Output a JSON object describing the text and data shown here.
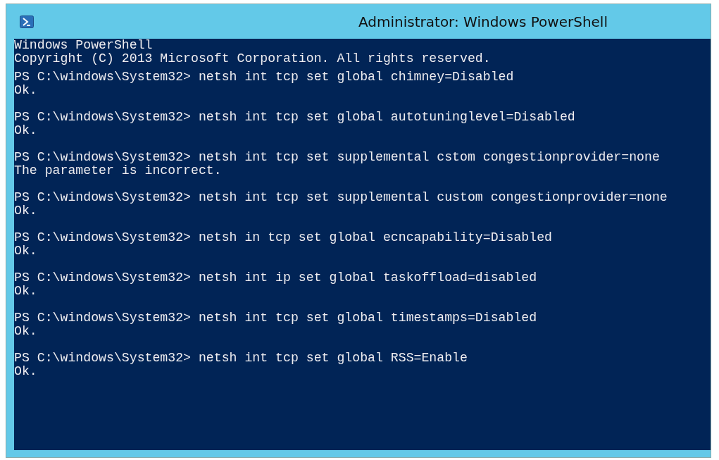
{
  "window": {
    "title": "Administrator: Windows PowerShell"
  },
  "console": {
    "header": [
      "Windows PowerShell",
      "Copyright (C) 2013 Microsoft Corporation. All rights reserved."
    ],
    "entries": [
      {
        "command": "PS C:\\windows\\System32> netsh int tcp set global chimney=Disabled",
        "output": "Ok."
      },
      {
        "command": "PS C:\\windows\\System32> netsh int tcp set global autotuninglevel=Disabled",
        "output": "Ok."
      },
      {
        "command": "PS C:\\windows\\System32> netsh int tcp set supplemental cstom congestionprovider=none",
        "output": "The parameter is incorrect."
      },
      {
        "command": "PS C:\\windows\\System32> netsh int tcp set supplemental custom congestionprovider=none",
        "output": "Ok."
      },
      {
        "command": "PS C:\\windows\\System32> netsh in tcp set global ecncapability=Disabled",
        "output": "Ok."
      },
      {
        "command": "PS C:\\windows\\System32> netsh int ip set global taskoffload=disabled",
        "output": "Ok."
      },
      {
        "command": "PS C:\\windows\\System32> netsh int tcp set global timestamps=Disabled",
        "output": "Ok."
      },
      {
        "command": "PS C:\\windows\\System32> netsh int tcp set global RSS=Enable",
        "output": "Ok."
      }
    ]
  }
}
